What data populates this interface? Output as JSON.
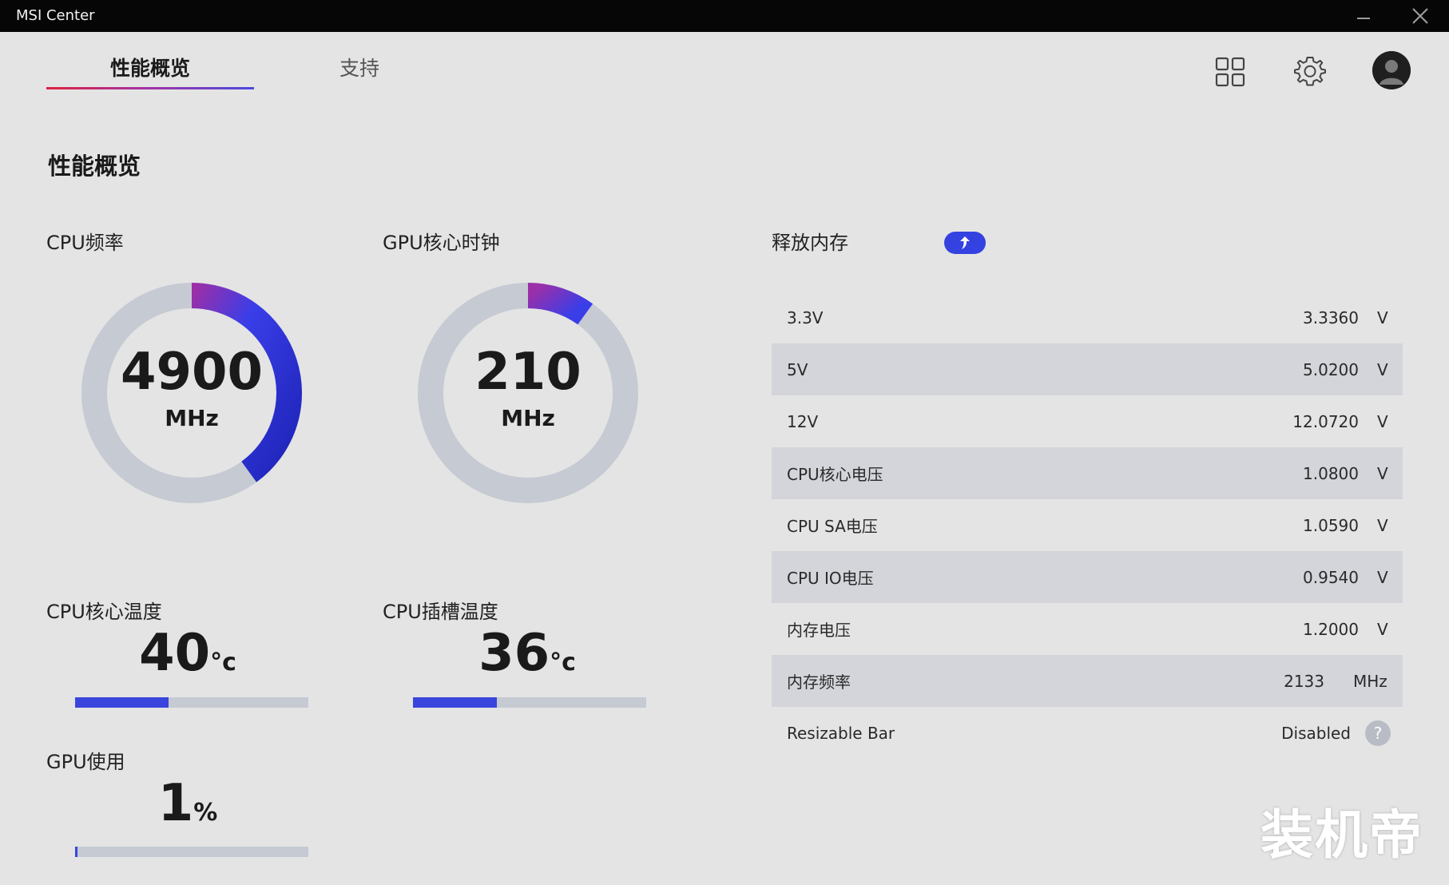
{
  "window": {
    "title": "MSI Center"
  },
  "tabs": [
    {
      "label": "性能概览",
      "active": true
    },
    {
      "label": "支持",
      "active": false
    }
  ],
  "header_icons": [
    "grid-icon",
    "gear-icon",
    "avatar"
  ],
  "page": {
    "title": "性能概览"
  },
  "cpu_freq": {
    "label": "CPU频率",
    "value": "4900",
    "unit": "MHz",
    "gauge_fraction": 0.4
  },
  "gpu_clock": {
    "label": "GPU核心时钟",
    "value": "210",
    "unit": "MHz",
    "gauge_fraction": 0.1
  },
  "cpu_core_temp": {
    "label": "CPU核心温度",
    "value": "40",
    "unit": "°c",
    "bar_fraction": 0.4
  },
  "cpu_socket_temp": {
    "label": "CPU插槽温度",
    "value": "36",
    "unit": "°c",
    "bar_fraction": 0.36
  },
  "gpu_usage": {
    "label": "GPU使用",
    "value": "1",
    "unit": "%",
    "bar_fraction": 0.01
  },
  "memory": {
    "label": "释放内存"
  },
  "voltages": [
    {
      "name": "3.3V",
      "value": "3.3360",
      "unit": "V"
    },
    {
      "name": "5V",
      "value": "5.0200",
      "unit": "V"
    },
    {
      "name": "12V",
      "value": "12.0720",
      "unit": "V"
    },
    {
      "name": "CPU核心电压",
      "value": "1.0800",
      "unit": "V"
    },
    {
      "name": "CPU SA电压",
      "value": "1.0590",
      "unit": "V"
    },
    {
      "name": "CPU IO电压",
      "value": "0.9540",
      "unit": "V"
    },
    {
      "name": "内存电压",
      "value": "1.2000",
      "unit": "V"
    },
    {
      "name": "内存频率",
      "value": "2133",
      "unit": "MHz"
    }
  ],
  "resizable_bar": {
    "name": "Resizable Bar",
    "value": "Disabled",
    "help": "?"
  },
  "watermark": "装机帝",
  "colors": {
    "accent": "#3a45dc",
    "gauge_track": "#c5cad3",
    "gradient_start": "#9b2fa8",
    "gradient_end": "#2026c6"
  }
}
